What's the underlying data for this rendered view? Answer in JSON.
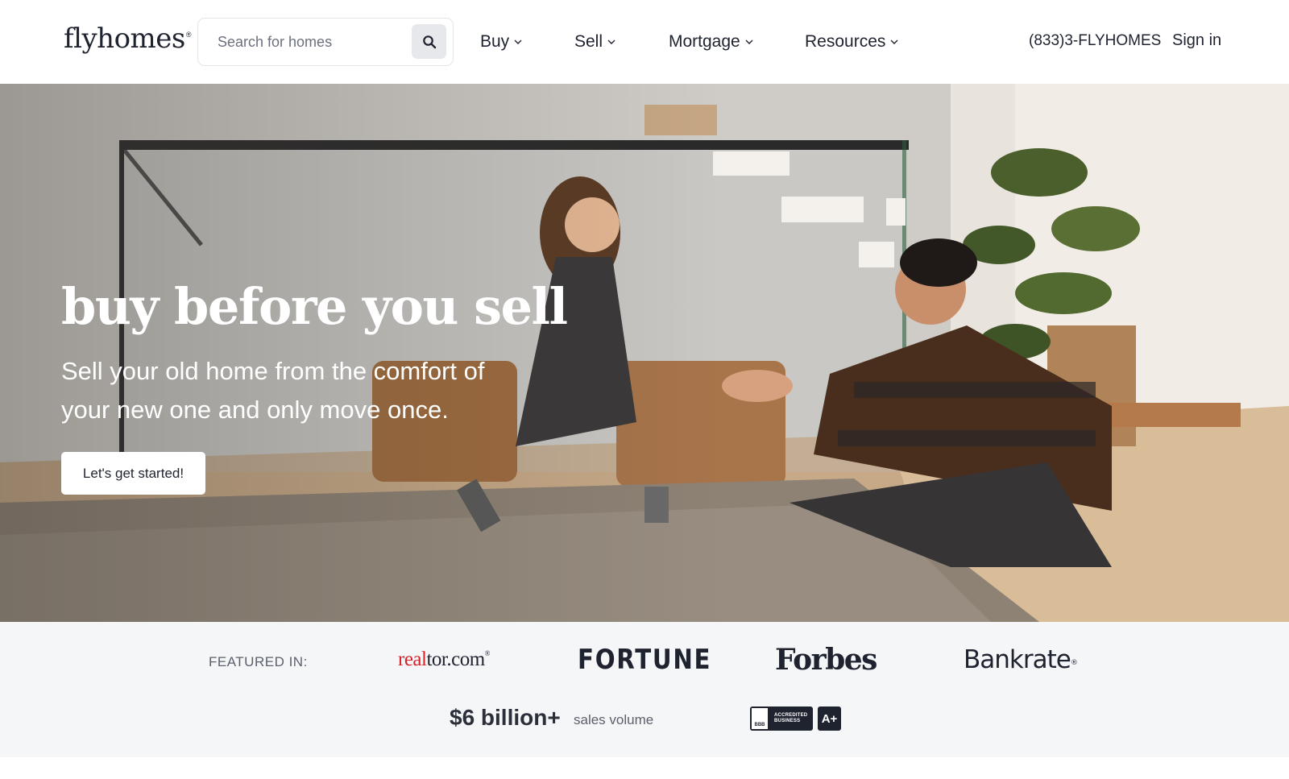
{
  "header": {
    "logo_text": "flyhomes",
    "logo_mark": "®",
    "search": {
      "placeholder": "Search for homes",
      "value": "",
      "icon": "search-icon"
    },
    "nav": [
      {
        "label": "Buy",
        "icon": "chevron-down-icon"
      },
      {
        "label": "Sell",
        "icon": "chevron-down-icon"
      },
      {
        "label": "Mortgage",
        "icon": "chevron-down-icon"
      },
      {
        "label": "Resources",
        "icon": "chevron-down-icon"
      }
    ],
    "phone": "(833)3-FLYHOMES",
    "sign_in": "Sign in"
  },
  "hero": {
    "title": "buy before you sell",
    "subtitle": "Sell your old home from the comfort of your new one and only move once.",
    "cta_label": "Let's get started!"
  },
  "featured": {
    "label": "FEATURED IN:",
    "press": {
      "realtor_a": "real",
      "realtor_b": "tor.com",
      "realtor_mark": "®",
      "fortune": "FORTUNE",
      "forbes": "Forbes",
      "bankrate": "Bankrate",
      "bankrate_mark": "®"
    },
    "stat_value": "$6 billion+",
    "stat_label": "sales volume",
    "bbb": {
      "mark": "BBB",
      "line1": "ACCREDITED",
      "line2": "BUSINESS",
      "rating": "A+"
    }
  },
  "colors": {
    "text_dark": "#1f2330",
    "muted": "#5b606b",
    "band_bg": "#f5f6f8",
    "realtor_red": "#d92228"
  }
}
